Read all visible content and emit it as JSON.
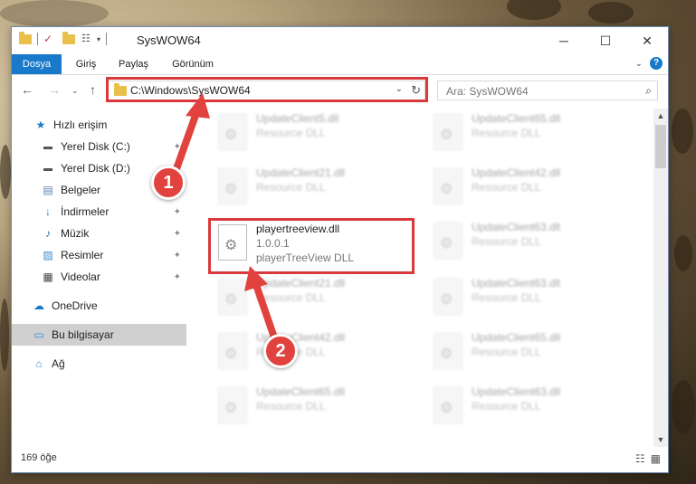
{
  "window": {
    "title": "SysWOW64"
  },
  "ribbon": {
    "tabs": [
      "Dosya",
      "Giriş",
      "Paylaş",
      "Görünüm"
    ]
  },
  "address": {
    "path": "C:\\Windows\\SysWOW64"
  },
  "search": {
    "placeholder": "Ara: SysWOW64"
  },
  "sidebar": {
    "items": [
      {
        "label": "Hızlı erişim"
      },
      {
        "label": "Yerel Disk (C:)"
      },
      {
        "label": "Yerel Disk (D:)"
      },
      {
        "label": "Belgeler"
      },
      {
        "label": "İndirmeler"
      },
      {
        "label": "Müzik"
      },
      {
        "label": "Resimler"
      },
      {
        "label": "Videolar"
      },
      {
        "label": "OneDrive"
      },
      {
        "label": "Bu bilgisayar"
      },
      {
        "label": "Ağ"
      }
    ]
  },
  "files": {
    "left": [
      {
        "name": "UpdateClient5.dll",
        "type": "Resource DLL"
      },
      {
        "name": "UpdateClient21.dll",
        "type": "Resource DLL"
      },
      {
        "name": "UpdateClient21.dll",
        "type": "Resource DLL"
      },
      {
        "name": "UpdateClient42.dll",
        "type": "Resource DLL"
      },
      {
        "name": "UpdateClient65.dll",
        "type": "Resource DLL"
      }
    ],
    "right": [
      {
        "name": "UpdateClient65.dll",
        "type": "Resource DLL"
      },
      {
        "name": "UpdateClient42.dll",
        "type": "Resource DLL"
      },
      {
        "name": "UpdateClient63.dll",
        "type": "Resource DLL"
      },
      {
        "name": "UpdateClient63.dll",
        "type": "Resource DLL"
      },
      {
        "name": "UpdateClient65.dll",
        "type": "Resource DLL"
      },
      {
        "name": "UpdateClient63.dll",
        "type": "Resource DLL"
      }
    ],
    "highlighted": {
      "name": "playertreeview.dll",
      "version": "1.0.0.1",
      "type": "playerTreeView DLL"
    }
  },
  "status": {
    "count": "169 öğe"
  },
  "badges": {
    "one": "1",
    "two": "2"
  },
  "colors": {
    "accent": "#1979ca",
    "annotation": "#d9393a"
  }
}
